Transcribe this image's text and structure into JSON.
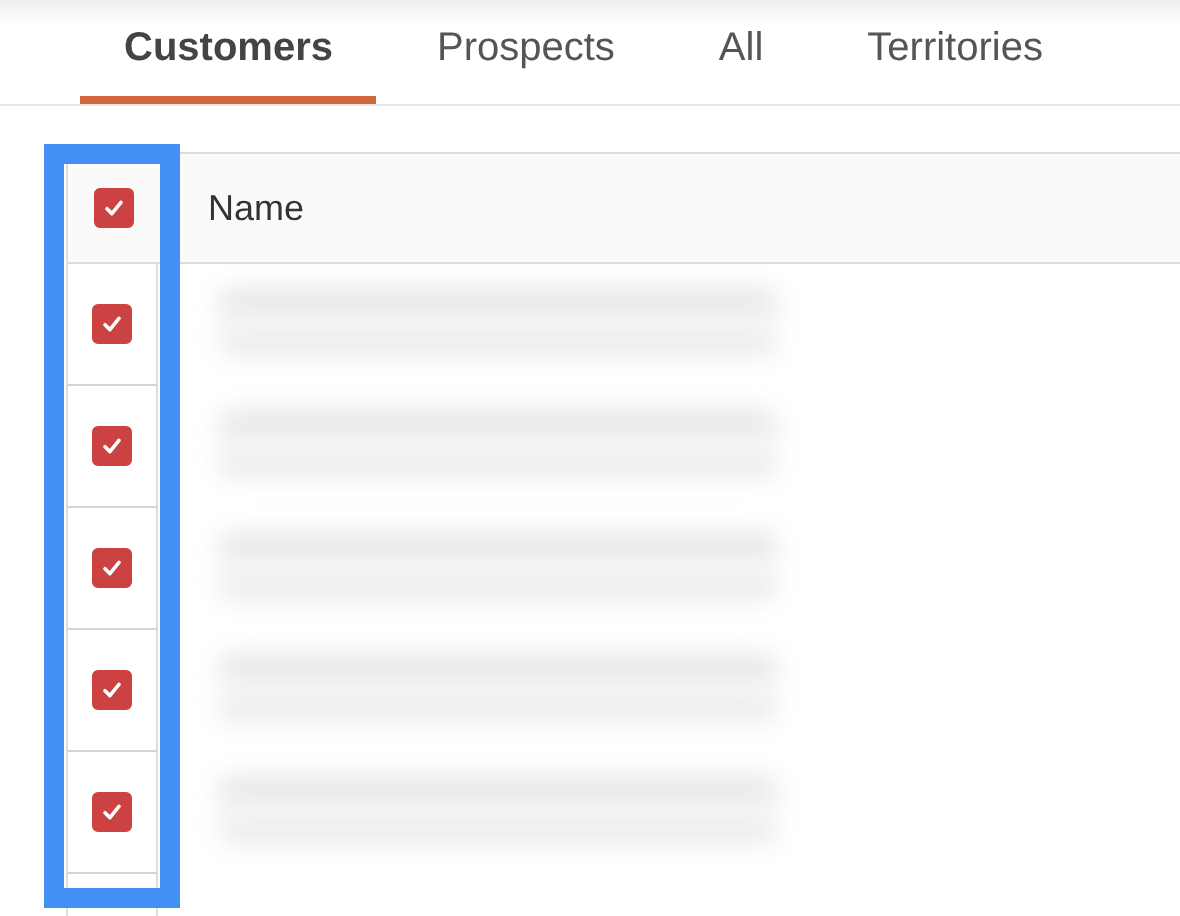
{
  "tabs": [
    {
      "label": "Customers",
      "selected": true
    },
    {
      "label": "Prospects",
      "selected": false
    },
    {
      "label": "All",
      "selected": false
    },
    {
      "label": "Territories",
      "selected": false
    }
  ],
  "table": {
    "header": {
      "label": "Name",
      "checked": true
    },
    "rows": [
      {
        "checked": true
      },
      {
        "checked": true
      },
      {
        "checked": true
      },
      {
        "checked": true
      },
      {
        "checked": true
      }
    ]
  }
}
